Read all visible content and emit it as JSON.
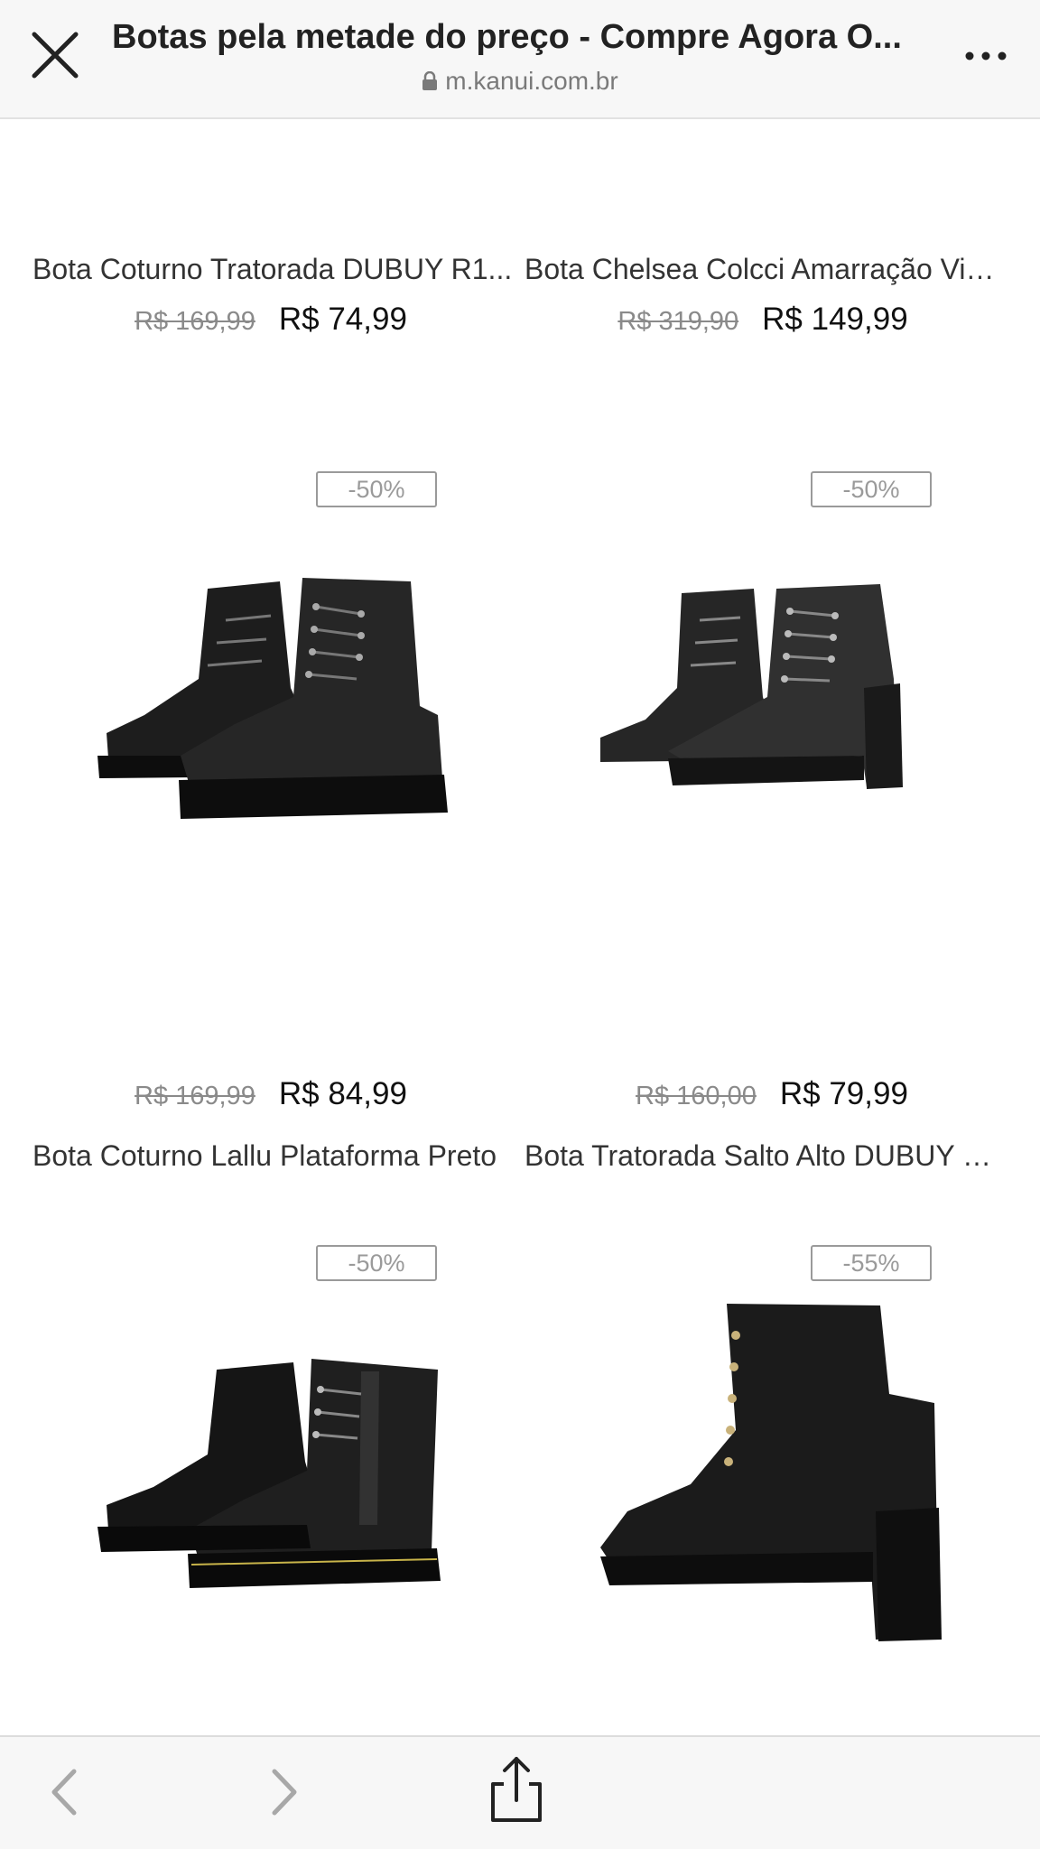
{
  "header": {
    "title": "Botas pela metade do preço - Compre Agora O...",
    "url": "m.kanui.com.br"
  },
  "products": [
    {
      "name": "Bota Coturno Tratorada DUBUY R1...",
      "old_price": "R$ 169,99",
      "price": "R$ 74,99"
    },
    {
      "name": "Bota Chelsea Colcci Amarração Vin...",
      "old_price": "R$ 319,90",
      "price": "R$ 149,99"
    },
    {
      "name": "Bota Coturno Lallu Plataforma Preto",
      "old_price": "R$ 169,99",
      "price": "R$ 84,99",
      "discount": "-50%"
    },
    {
      "name": "Bota Tratorada Salto Alto DUBUY R...",
      "old_price": "R$ 160,00",
      "price": "R$ 79,99",
      "discount": "-50%"
    },
    {
      "discount": "-50%"
    },
    {
      "discount": "-55%"
    }
  ],
  "icons": {
    "close": "close-icon",
    "lock": "lock-icon",
    "more": "more-icon",
    "back": "chevron-left-icon",
    "forward": "chevron-right-icon",
    "share": "share-icon"
  }
}
